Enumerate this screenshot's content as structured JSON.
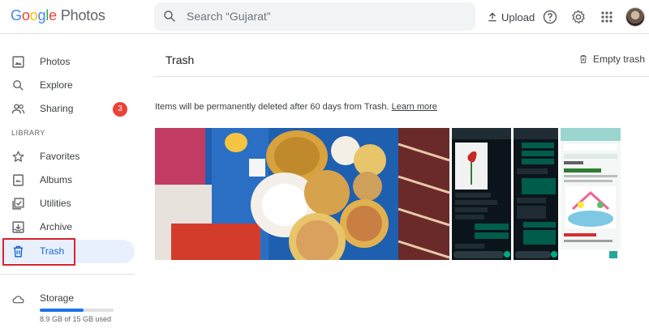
{
  "app": {
    "logo_google": [
      "G",
      "o",
      "o",
      "g",
      "l",
      "e"
    ],
    "logo_product": "Photos"
  },
  "search": {
    "placeholder": "Search “Gujarat”"
  },
  "header": {
    "upload_label": "Upload",
    "icons": [
      "help-icon",
      "settings-icon",
      "apps-grid-icon"
    ]
  },
  "sidebar": {
    "items": [
      {
        "label": "Photos",
        "icon": "photo-icon"
      },
      {
        "label": "Explore",
        "icon": "search-icon"
      },
      {
        "label": "Sharing",
        "icon": "people-icon",
        "badge": "3"
      }
    ],
    "library_label": "LIBRARY",
    "library_items": [
      {
        "label": "Favorites",
        "icon": "star-icon"
      },
      {
        "label": "Albums",
        "icon": "album-icon"
      },
      {
        "label": "Utilities",
        "icon": "utilities-icon"
      },
      {
        "label": "Archive",
        "icon": "archive-icon"
      },
      {
        "label": "Trash",
        "icon": "trash-icon",
        "active": true
      }
    ],
    "storage": {
      "label": "Storage",
      "used_text": "8.9 GB of 15 GB used",
      "used_fraction": 0.593
    }
  },
  "main": {
    "title": "Trash",
    "empty_trash_label": "Empty trash",
    "notice_text": "Items will be permanently deleted after 60 days from Trash.",
    "learn_more": "Learn more",
    "photos": [
      {
        "name": "food-thali-photo"
      },
      {
        "name": "chat-screenshot-1"
      },
      {
        "name": "chat-screenshot-2"
      },
      {
        "name": "shopping-screenshot"
      }
    ]
  },
  "colors": {
    "accent": "#1a73e8",
    "active_bg": "#e8f0fe",
    "badge": "#ea4335",
    "highlight_box": "#d9232e"
  }
}
